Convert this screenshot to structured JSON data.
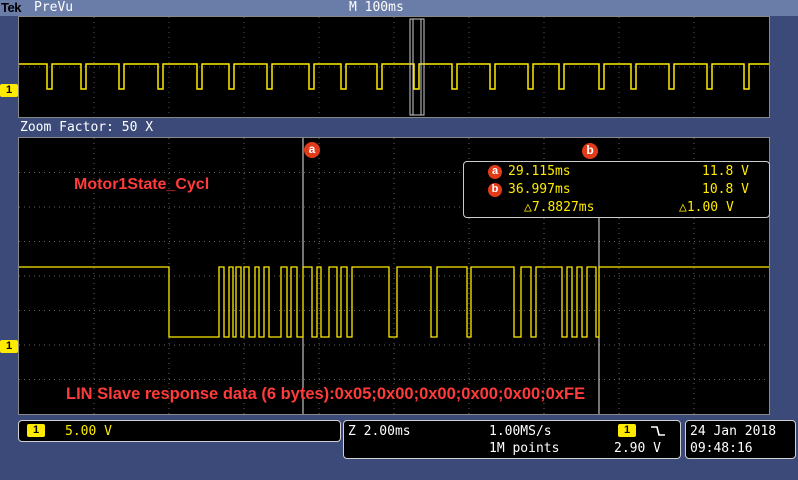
{
  "header": {
    "brand": "Tek",
    "mode": "PreVu",
    "timebase": "M 100ms"
  },
  "zoom": {
    "label": "Zoom Factor: 50 X"
  },
  "channel": {
    "marker": "1",
    "color": "#ffeb00"
  },
  "cursors": {
    "a_label": "a",
    "b_label": "b",
    "a_time": "29.115ms",
    "a_volt": "11.8 V",
    "b_time": "36.997ms",
    "b_volt": "10.8 V",
    "delta_time": "△7.8827ms",
    "delta_volt": "△1.00 V",
    "color": "#e23b1a"
  },
  "annotations": {
    "frame_name": "Motor1State_Cycl",
    "response": "LIN Slave response data (6 bytes):0x05;0x00;0x00;0x00;0x00;0xFE"
  },
  "status": {
    "ch_scale": "5.00 V",
    "zoom_time": "Z 2.00ms",
    "sample_rate": "1.00MS/s",
    "points": "1M points",
    "trigger_level": "2.90 V",
    "trigger_slope_icon": "falling-edge-icon",
    "date": "24 Jan  2018",
    "time": "09:48:16"
  }
}
